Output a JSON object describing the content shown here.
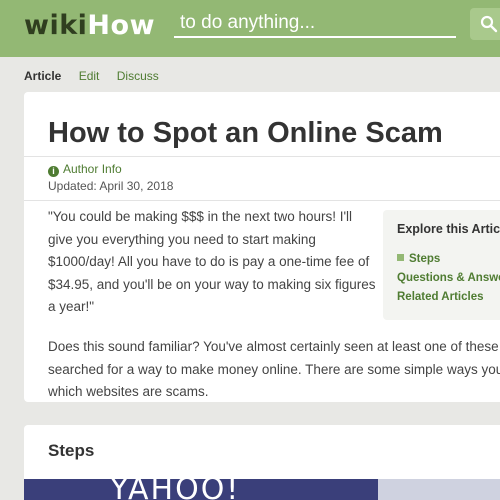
{
  "header": {
    "logo_wiki": "wiki",
    "logo_how": "How",
    "search_placeholder": "to do anything...",
    "search_icon": "search-icon",
    "bg_color": "#93b874"
  },
  "tabs": [
    {
      "label": "Article",
      "active": true
    },
    {
      "label": "Edit",
      "active": false
    },
    {
      "label": "Discuss",
      "active": false
    }
  ],
  "article": {
    "title": "How to Spot an Online Scam",
    "author_info": "Author Info",
    "updated": "Updated: April 30, 2018",
    "quote": "\"You could be making $$$ in the next two hours! I'll give you everything you need to start making $1000/day! All you have to do is pay a one-time fee of $34.95, and you'll be on your way to making six figures a year!\"",
    "para_lines": [
      "Does this sound familiar? You've almost certainly seen at least one of these",
      "searched for a way to make money online. There are some simple ways you",
      "which websites are scams."
    ]
  },
  "explore": {
    "title": "Explore this Article",
    "items": [
      "Steps",
      "Questions & Answers",
      "Related Articles"
    ]
  },
  "steps": {
    "heading": "Steps",
    "image_text": "YAHOO!"
  },
  "colors": {
    "link_green": "#4f7c32",
    "page_bg": "#e8e8e5"
  }
}
